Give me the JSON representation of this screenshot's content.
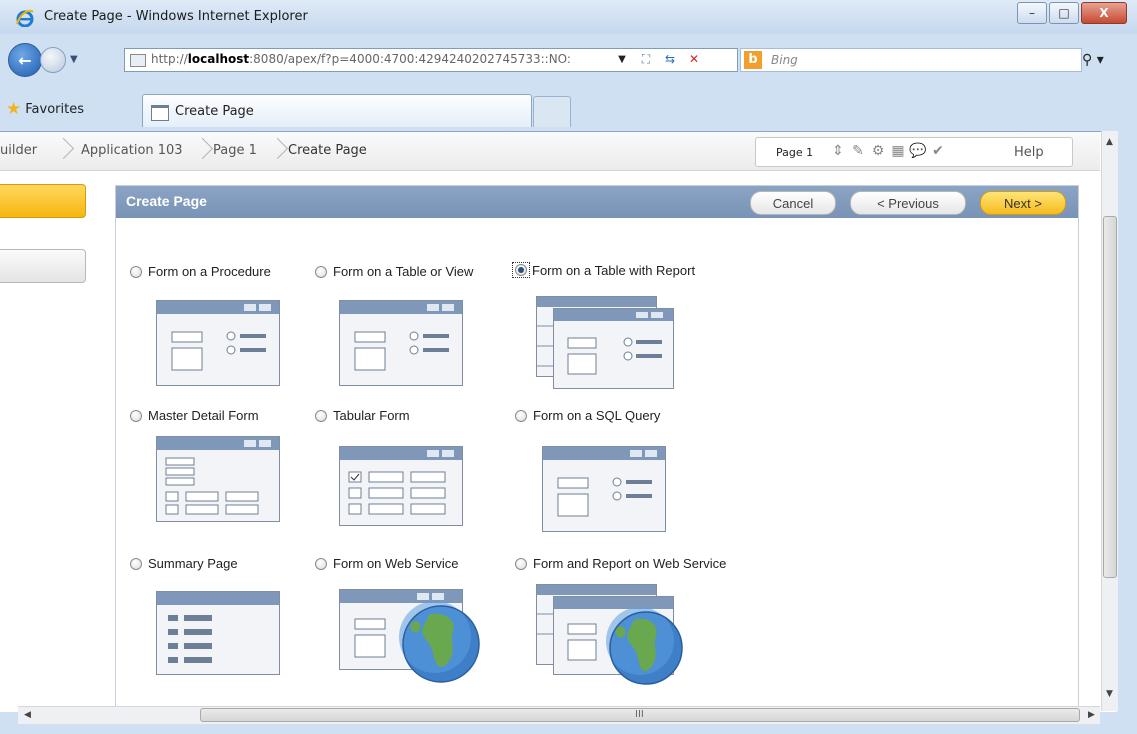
{
  "window": {
    "title": "Create Page - Windows Internet Explorer",
    "minimize": "–",
    "maximize": "□",
    "close": "X"
  },
  "browser": {
    "url_prefix": "http://",
    "url_host": "localhost",
    "url_rest": ":8080/apex/f?p=4000:4700:4294240202745733::NO:",
    "search_engine": "Bing",
    "favorites_label": "Favorites",
    "tab_label": "Create Page"
  },
  "breadcrumb": {
    "items": [
      "uilder",
      "Application 103",
      "Page 1",
      "Create Page"
    ]
  },
  "page_toolbar": {
    "page_label": "Page 1",
    "help_label": "Help"
  },
  "panel": {
    "title": "Create Page",
    "cancel_label": "Cancel",
    "previous_label": "< Previous",
    "next_label": "Next >"
  },
  "options": [
    {
      "label": "Form on a Procedure",
      "selected": false,
      "icon": "form-thumbnail"
    },
    {
      "label": "Form on a Table or View",
      "selected": false,
      "icon": "form-thumbnail"
    },
    {
      "label": "Form on a Table with Report",
      "selected": true,
      "icon": "form-report-thumbnail"
    },
    {
      "label": "Master Detail Form",
      "selected": false,
      "icon": "master-detail-thumbnail"
    },
    {
      "label": "Tabular Form",
      "selected": false,
      "icon": "tabular-thumbnail"
    },
    {
      "label": "Form on a SQL Query",
      "selected": false,
      "icon": "form-thumbnail"
    },
    {
      "label": "Summary Page",
      "selected": false,
      "icon": "summary-thumbnail"
    },
    {
      "label": "Form on Web Service",
      "selected": false,
      "icon": "web-service-thumbnail"
    },
    {
      "label": "Form and Report on Web Service",
      "selected": false,
      "icon": "web-service-report-thumbnail"
    }
  ],
  "scrollbar": {
    "h_grip": "III"
  },
  "colors": {
    "panel_header": "#7f98ba",
    "next_button": "#f6bb1a",
    "sidebar_active": "#f6b60f"
  }
}
